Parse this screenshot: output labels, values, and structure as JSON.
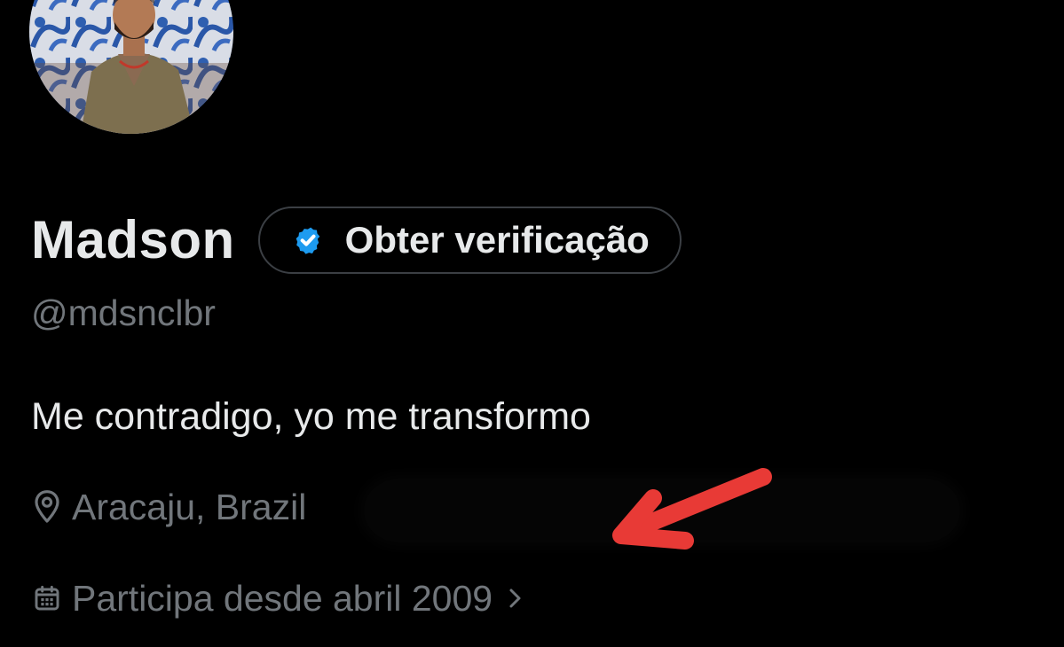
{
  "profile": {
    "display_name": "Madson",
    "verify_label": "Obter verificação",
    "handle": "@mdsnclbr",
    "bio": "Me contradigo, yo me transformo",
    "location": "Aracaju, Brazil",
    "joined": "Participa desde abril 2009"
  },
  "icons": {
    "verified": "verified-badge-icon",
    "location": "map-pin-icon",
    "calendar": "calendar-icon",
    "chevron": "chevron-right-icon",
    "annotation": "arrow-annotation"
  },
  "colors": {
    "background": "#000000",
    "primary_text": "#e7e9ea",
    "secondary_text": "#71767b",
    "verified_blue": "#1d9bf0",
    "pill_border": "#3b3f44",
    "annotation_red": "#e83a36"
  }
}
